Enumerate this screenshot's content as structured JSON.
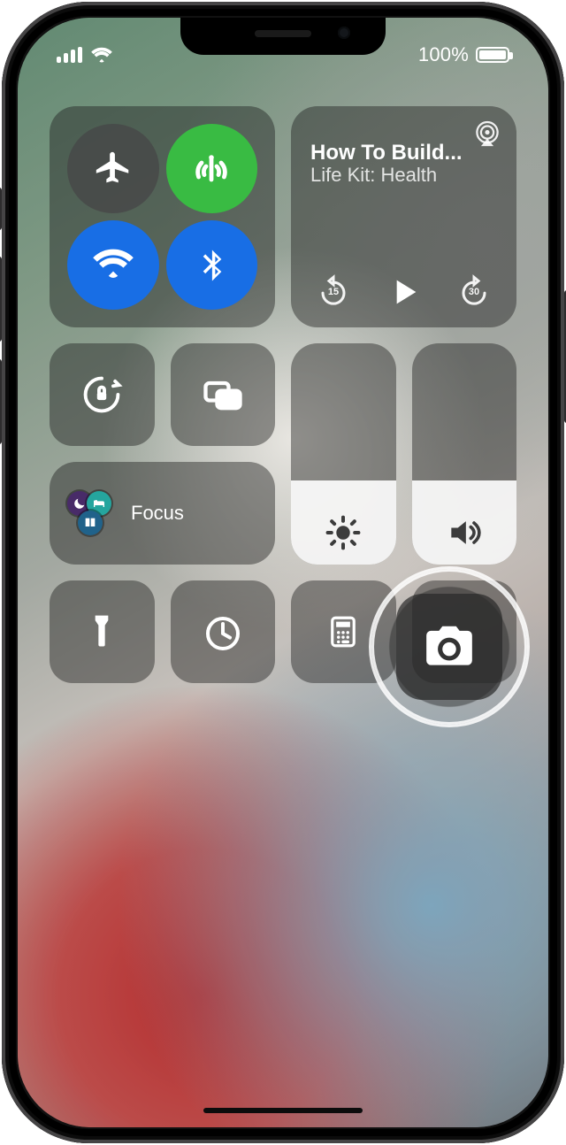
{
  "status": {
    "battery_percent": "100%"
  },
  "media": {
    "title": "How To Build...",
    "subtitle": "Life Kit: Health",
    "back_seconds": "15",
    "forward_seconds": "30"
  },
  "focus": {
    "label": "Focus"
  },
  "icons": {
    "airplane": "airplane-icon",
    "cellular": "cellular-data-icon",
    "wifi": "wifi-icon",
    "bluetooth": "bluetooth-icon",
    "airplay": "airplay-icon",
    "orientation_lock": "orientation-lock-icon",
    "screen_mirroring": "screen-mirroring-icon",
    "brightness": "brightness-icon",
    "volume": "volume-icon",
    "flashlight": "flashlight-icon",
    "timer": "timer-icon",
    "calculator": "calculator-icon",
    "camera": "camera-icon",
    "moon": "moon-icon",
    "bed": "bed-icon",
    "book": "book-icon"
  },
  "sliders": {
    "brightness": 0.38,
    "volume": 0.38
  },
  "colors": {
    "tile_bg": "rgba(30,30,30,0.44)",
    "toggle_green": "#2fbf3a",
    "toggle_blue": "#0f6ff3"
  }
}
